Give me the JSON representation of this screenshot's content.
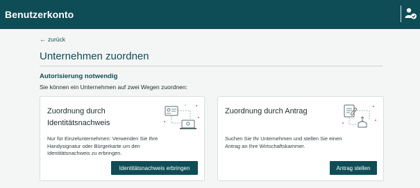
{
  "header": {
    "title": "Benutzerkonto",
    "user_icon": "user-check-icon"
  },
  "back_link": {
    "label": "zurück",
    "icon": "arrow-left-icon"
  },
  "page_title": "Unternehmen zuordnen",
  "section": {
    "heading": "Autorisierung notwendig",
    "intro": "Sie können ein Unternehmen auf zwei Wegen zuordnen:"
  },
  "cards": [
    {
      "title_line1": "Zuordnung durch",
      "title_line2": "Identitätsnachweis",
      "illustration": "id-verification-icon",
      "text_line1": "Nur für Einzelunternehmen: Verwenden Sie Ihre",
      "text_line2": "Handysignatur oder Bürgerkarte um den",
      "text_line3": "Identitätsnachweis zu erbringen.",
      "button_label": "Identitätsnachweis erbringen"
    },
    {
      "title_line1": "Zuordnung durch Antrag",
      "illustration": "application-form-icon",
      "text_line1": "Suchen Sie Ihr Unternehmen und stellen Sie einen",
      "text_line2": "Antrag an Ihre Wirtschaftskammer.",
      "button_label": "Antrag stellen"
    }
  ],
  "colors": {
    "brand": "#0f4d56",
    "background": "#f4f5f5",
    "card": "#ffffff",
    "accent_red": "#d6243a"
  }
}
